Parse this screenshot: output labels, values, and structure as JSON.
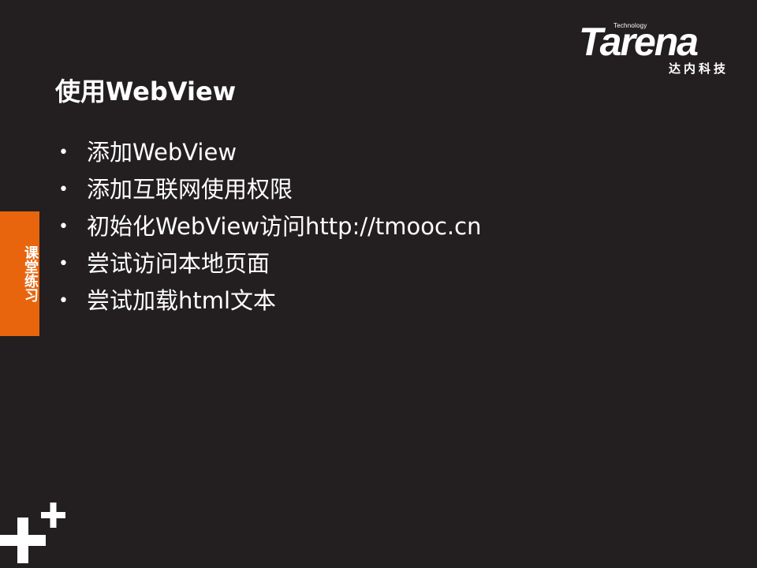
{
  "logo": {
    "technology": "Technology",
    "brand": "Tarena",
    "chinese": "达内科技"
  },
  "title": "使用WebView",
  "bullets": [
    "添加WebView",
    "添加互联网使用权限",
    "初始化WebView访问http://tmooc.cn",
    "尝试访问本地页面",
    "尝试加载html文本"
  ],
  "side_tab": {
    "label": "课堂练习"
  },
  "colors": {
    "background": "#231f20",
    "accent": "#e8650e",
    "text": "#ffffff"
  },
  "icons": {
    "bullet": "bullet-dot-icon",
    "decoration": "plus-plus-icon"
  }
}
